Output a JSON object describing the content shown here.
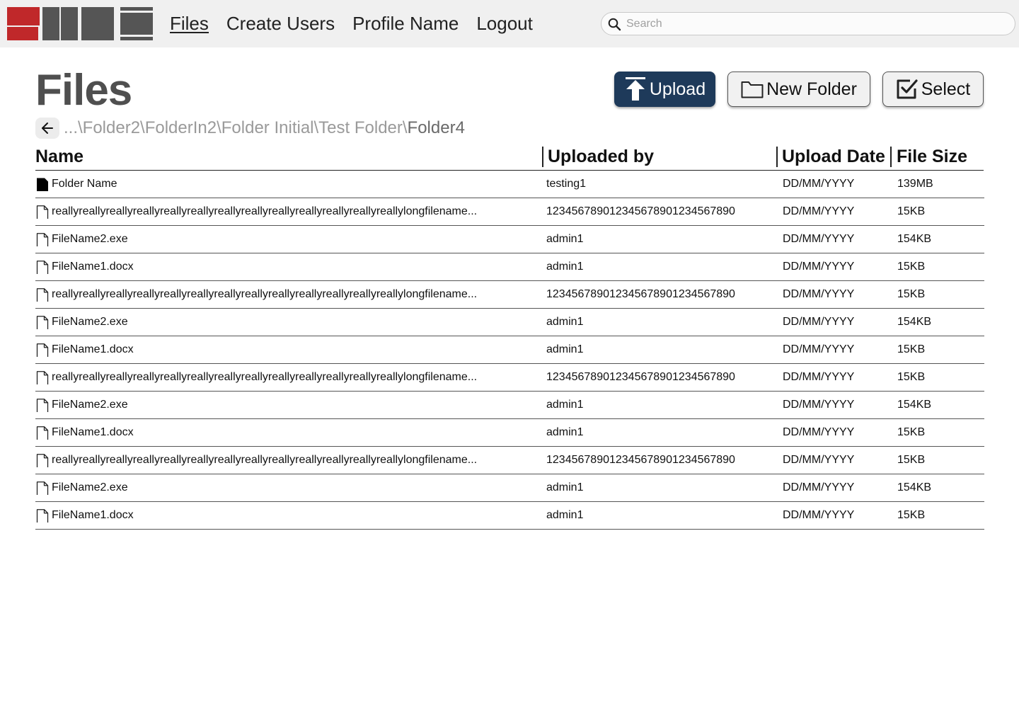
{
  "app": {
    "logo_colors": [
      "#c0282a",
      "#555555"
    ]
  },
  "nav": {
    "items": [
      {
        "label": "Files",
        "active": true
      },
      {
        "label": "Create Users",
        "active": false
      },
      {
        "label": "Profile Name",
        "active": false
      },
      {
        "label": "Logout",
        "active": false
      }
    ]
  },
  "search": {
    "placeholder": "Search",
    "value": "",
    "icon": "search-icon"
  },
  "page": {
    "title": "Files"
  },
  "actions": {
    "upload_label": "Upload",
    "new_folder_label": "New Folder",
    "select_label": "Select",
    "upload_color": "#1e3a5a"
  },
  "breadcrumb": {
    "back_icon": "arrow-left-icon",
    "path": "...\\Folder2\\FolderIn2\\Folder Initial\\Test Folder\\",
    "current": "Folder4"
  },
  "table": {
    "headers": {
      "name": "Name",
      "uploaded_by": "Uploaded by",
      "upload_date": "Upload Date",
      "file_size": "File Size"
    },
    "rows": [
      {
        "type": "folder",
        "name": "Folder Name",
        "uploaded_by": "testing1",
        "date": "DD/MM/YYYY",
        "size": "139MB"
      },
      {
        "type": "file",
        "name": "reallyreallyreallyreallyreallyreallyreallyreallyreallyreallyreallyreallyreallylongfilename...",
        "uploaded_by": "123456789012345678901234567890",
        "date": "DD/MM/YYYY",
        "size": "15KB"
      },
      {
        "type": "file",
        "name": "FileName2.exe",
        "uploaded_by": "admin1",
        "date": "DD/MM/YYYY",
        "size": "154KB"
      },
      {
        "type": "file",
        "name": "FileName1.docx",
        "uploaded_by": "admin1",
        "date": "DD/MM/YYYY",
        "size": "15KB"
      },
      {
        "type": "file",
        "name": "reallyreallyreallyreallyreallyreallyreallyreallyreallyreallyreallyreallyreallylongfilename...",
        "uploaded_by": "123456789012345678901234567890",
        "date": "DD/MM/YYYY",
        "size": "15KB"
      },
      {
        "type": "file",
        "name": "FileName2.exe",
        "uploaded_by": "admin1",
        "date": "DD/MM/YYYY",
        "size": "154KB"
      },
      {
        "type": "file",
        "name": "FileName1.docx",
        "uploaded_by": "admin1",
        "date": "DD/MM/YYYY",
        "size": "15KB"
      },
      {
        "type": "file",
        "name": "reallyreallyreallyreallyreallyreallyreallyreallyreallyreallyreallyreallyreallylongfilename...",
        "uploaded_by": "123456789012345678901234567890",
        "date": "DD/MM/YYYY",
        "size": "15KB"
      },
      {
        "type": "file",
        "name": "FileName2.exe",
        "uploaded_by": "admin1",
        "date": "DD/MM/YYYY",
        "size": "154KB"
      },
      {
        "type": "file",
        "name": "FileName1.docx",
        "uploaded_by": "admin1",
        "date": "DD/MM/YYYY",
        "size": "15KB"
      },
      {
        "type": "file",
        "name": "reallyreallyreallyreallyreallyreallyreallyreallyreallyreallyreallyreallyreallylongfilename...",
        "uploaded_by": "123456789012345678901234567890",
        "date": "DD/MM/YYYY",
        "size": "15KB"
      },
      {
        "type": "file",
        "name": "FileName2.exe",
        "uploaded_by": "admin1",
        "date": "DD/MM/YYYY",
        "size": "154KB"
      },
      {
        "type": "file",
        "name": "FileName1.docx",
        "uploaded_by": "admin1",
        "date": "DD/MM/YYYY",
        "size": "15KB"
      }
    ]
  }
}
